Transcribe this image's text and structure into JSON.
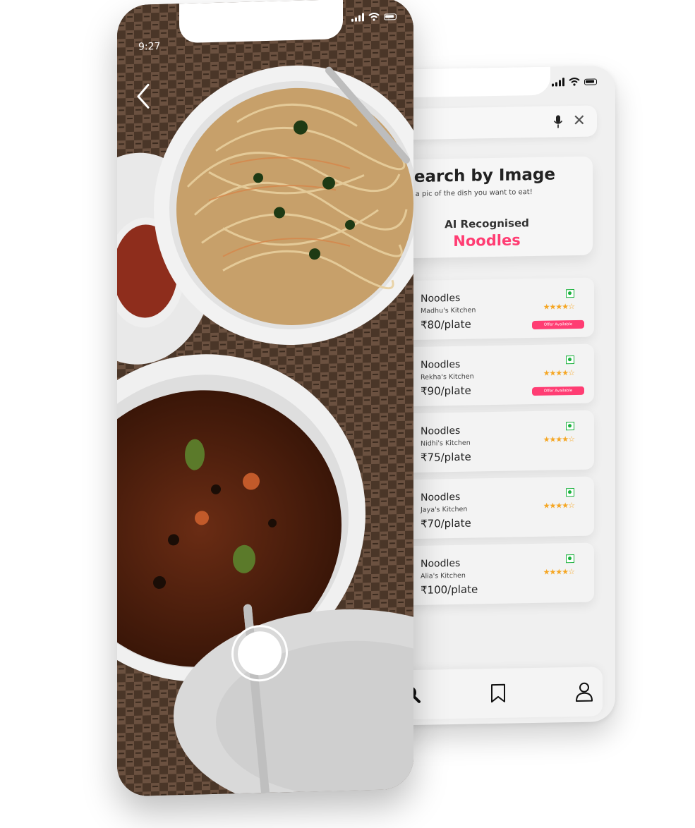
{
  "front_phone": {
    "time": "9:27",
    "icons": {
      "back": "back-arrow-icon",
      "shutter": "camera-shutter-button",
      "signal": "signal-icon",
      "wifi": "wifi-icon",
      "battery": "battery-icon"
    }
  },
  "back_phone": {
    "search": {
      "mic_icon": "mic-icon",
      "close_label": "✕"
    },
    "ai_card": {
      "title": "AI Search by Image",
      "subtitle": "or upload a pic of the dish you want to eat!",
      "recognised_label": "AI Recognised",
      "recognised_dish": "Noodles"
    },
    "results": [
      {
        "name": "Noodles",
        "kitchen": "Madhu's Kitchen",
        "price": "₹80/plate",
        "stars": "★★★★☆",
        "offer": "Offer Available"
      },
      {
        "name": "Noodles",
        "kitchen": "Rekha's Kitchen",
        "price": "₹90/plate",
        "stars": "★★★★☆",
        "offer": "Offer Available"
      },
      {
        "name": "Noodles",
        "kitchen": "Nidhi's Kitchen",
        "price": "₹75/plate",
        "stars": "★★★★☆",
        "offer": ""
      },
      {
        "name": "Noodles",
        "kitchen": "Jaya's Kitchen",
        "price": "₹70/plate",
        "stars": "★★★★☆",
        "offer": ""
      },
      {
        "name": "Noodles",
        "kitchen": "Alia's Kitchen",
        "price": "₹100/plate",
        "stars": "★★★★☆",
        "offer": ""
      }
    ],
    "tabbar": {
      "icons": [
        "search-icon",
        "bookmark-icon",
        "profile-icon"
      ]
    }
  },
  "colors": {
    "accent": "#ff3d73",
    "veg": "#18b13b",
    "star": "#f5a623"
  }
}
